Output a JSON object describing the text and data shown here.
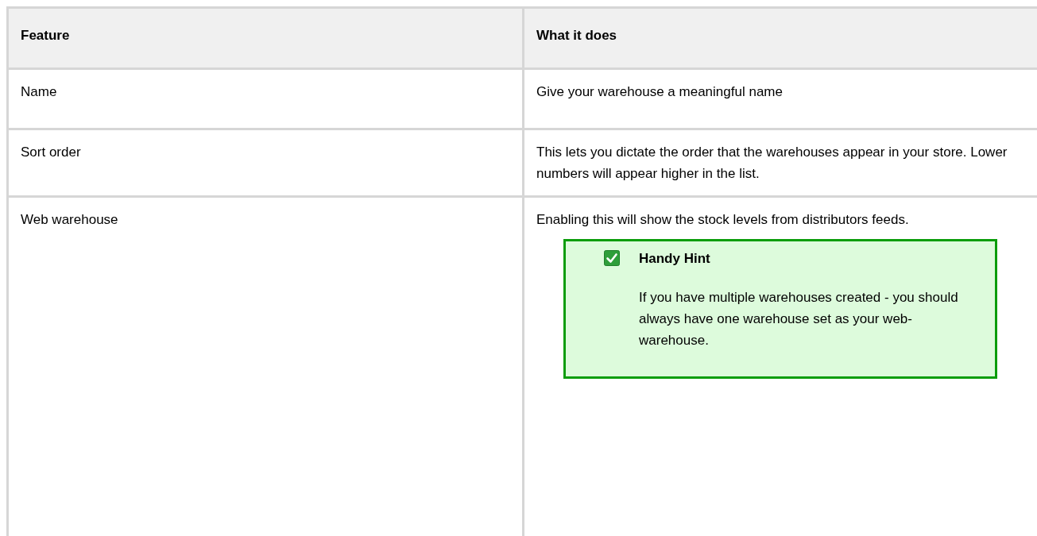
{
  "table": {
    "columns": [
      "Feature",
      "What it does"
    ],
    "rows": [
      {
        "feature": "Name",
        "description": "Give your warehouse a meaningful name"
      },
      {
        "feature": "Sort order",
        "description": "This lets you dictate the order that the warehouses appear in your store. Lower numbers will appear higher in the list."
      },
      {
        "feature": "Web warehouse",
        "description": "Enabling this will show the stock levels from distributors feeds.",
        "hint": {
          "title": "Handy Hint",
          "text": "If you have multiple warehouses created - you should always have one warehouse set as your web-warehouse."
        }
      }
    ]
  }
}
